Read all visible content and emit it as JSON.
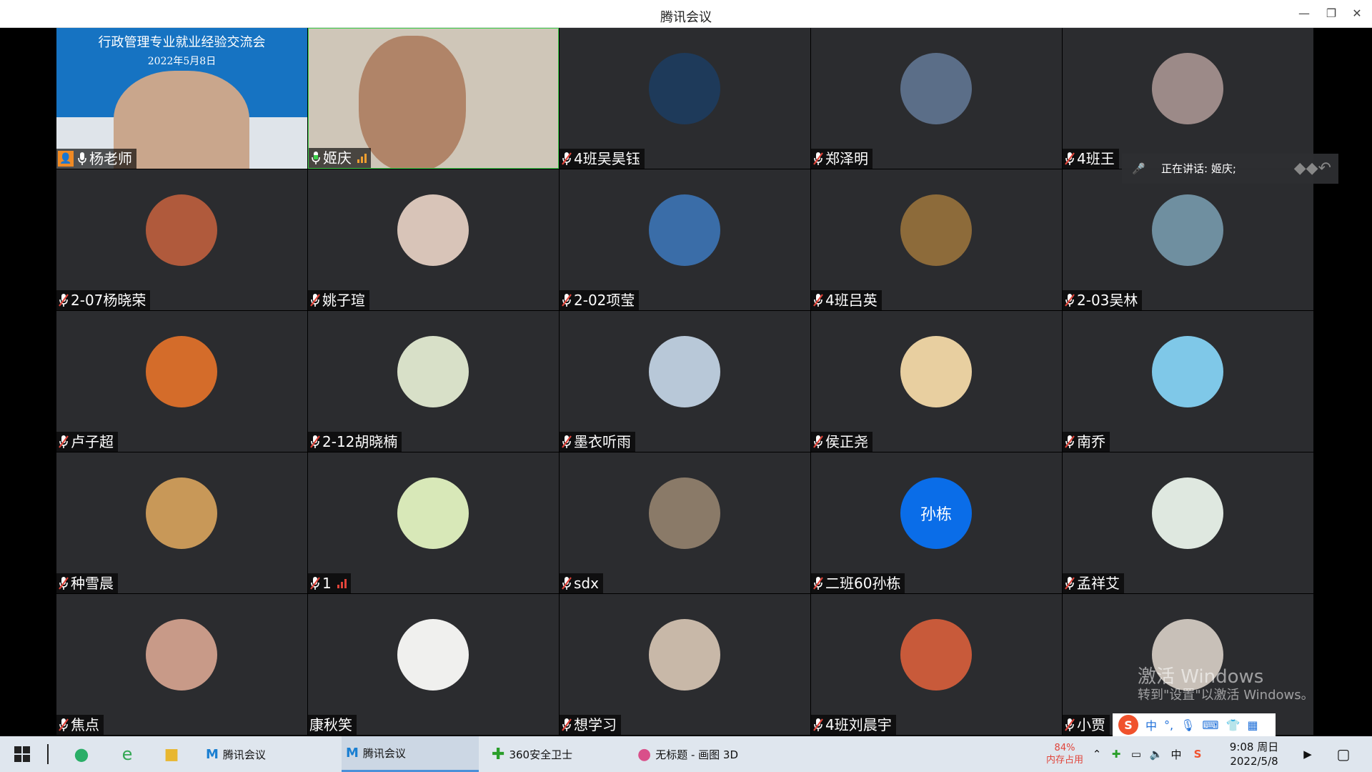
{
  "window": {
    "title": "腾讯会议"
  },
  "first_tile": {
    "banner_title": "行政管理专业就业经验交流会",
    "banner_date": "2022年5月8日"
  },
  "participants": [
    {
      "name": "杨老师",
      "mic": "on",
      "host": true
    },
    {
      "name": "姬庆",
      "mic": "on",
      "signal": "orange"
    },
    {
      "name": "4班吴昊钰",
      "mic": "muted"
    },
    {
      "name": "郑泽明",
      "mic": "muted"
    },
    {
      "name": "4班王",
      "mic": "muted"
    },
    {
      "name": "2-07杨晓荣",
      "mic": "muted"
    },
    {
      "name": "姚子瑄",
      "mic": "muted"
    },
    {
      "name": "2-02项莹",
      "mic": "muted"
    },
    {
      "name": "4班吕英",
      "mic": "muted"
    },
    {
      "name": "2-03吴林",
      "mic": "muted"
    },
    {
      "name": "卢子超",
      "mic": "muted"
    },
    {
      "name": "2-12胡晓楠",
      "mic": "muted"
    },
    {
      "name": "墨衣听雨",
      "mic": "muted"
    },
    {
      "name": "侯正尧",
      "mic": "muted"
    },
    {
      "name": "南乔",
      "mic": "muted"
    },
    {
      "name": "种雪晨",
      "mic": "muted"
    },
    {
      "name": "1",
      "mic": "muted",
      "signal": "red"
    },
    {
      "name": "sdx",
      "mic": "muted"
    },
    {
      "name": "二班60孙栋",
      "mic": "muted",
      "avatar_text": "孙栋"
    },
    {
      "name": "孟祥艾",
      "mic": "muted"
    },
    {
      "name": "焦点",
      "mic": "muted"
    },
    {
      "name": "康秋笑",
      "mic": "none"
    },
    {
      "name": "想学习",
      "mic": "muted"
    },
    {
      "name": "4班刘晨宇",
      "mic": "muted"
    },
    {
      "name": "小贾",
      "mic": "muted"
    }
  ],
  "speaking": {
    "label": "正在讲话: 姬庆;"
  },
  "watermark": {
    "line1": "激活 Windows",
    "line2": "转到\"设置\"以激活 Windows。"
  },
  "taskbar": {
    "apps": [
      {
        "label": "腾讯会议"
      },
      {
        "label": "腾讯会议"
      },
      {
        "label": "360安全卫士"
      },
      {
        "label": "无标题 - 画图 3D"
      }
    ],
    "memory_percent": "84%",
    "memory_label": "内存占用",
    "time": "9:08 周日",
    "date": "2022/5/8"
  },
  "ime": {
    "mode": "中"
  },
  "colors": {
    "muted_mic": "#e0443a",
    "active_mic": "#3ecf4a",
    "accent": "#1a7fd1"
  }
}
